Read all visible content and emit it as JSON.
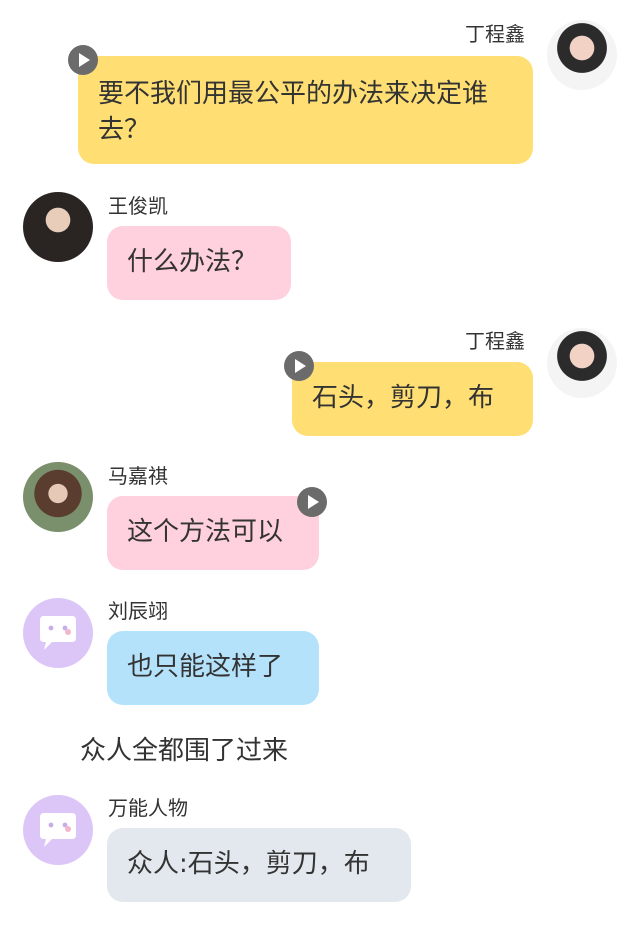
{
  "messages": [
    {
      "sender": "丁程鑫",
      "text": "要不我们用最公平的办法来决定谁去？"
    },
    {
      "sender": "王俊凯",
      "text": "什么办法？"
    },
    {
      "sender": "丁程鑫",
      "text": "石头，剪刀，布"
    },
    {
      "sender": "马嘉祺",
      "text": "这个方法可以"
    },
    {
      "sender": "刘辰翊",
      "text": "也只能这样了"
    },
    {
      "narration": "众人全都围了过来"
    },
    {
      "sender": "万能人物",
      "text": "众人:石头，剪刀，布"
    }
  ],
  "icons": {
    "audio": "play-icon",
    "default_avatar": "chat-bubble-face-icon"
  },
  "colors": {
    "yellow": "#ffdf73",
    "pink": "#ffd0dd",
    "blue": "#b5e2fb",
    "grey": "#e3e8ee",
    "default_avatar_bg": "#dcc6f7"
  }
}
